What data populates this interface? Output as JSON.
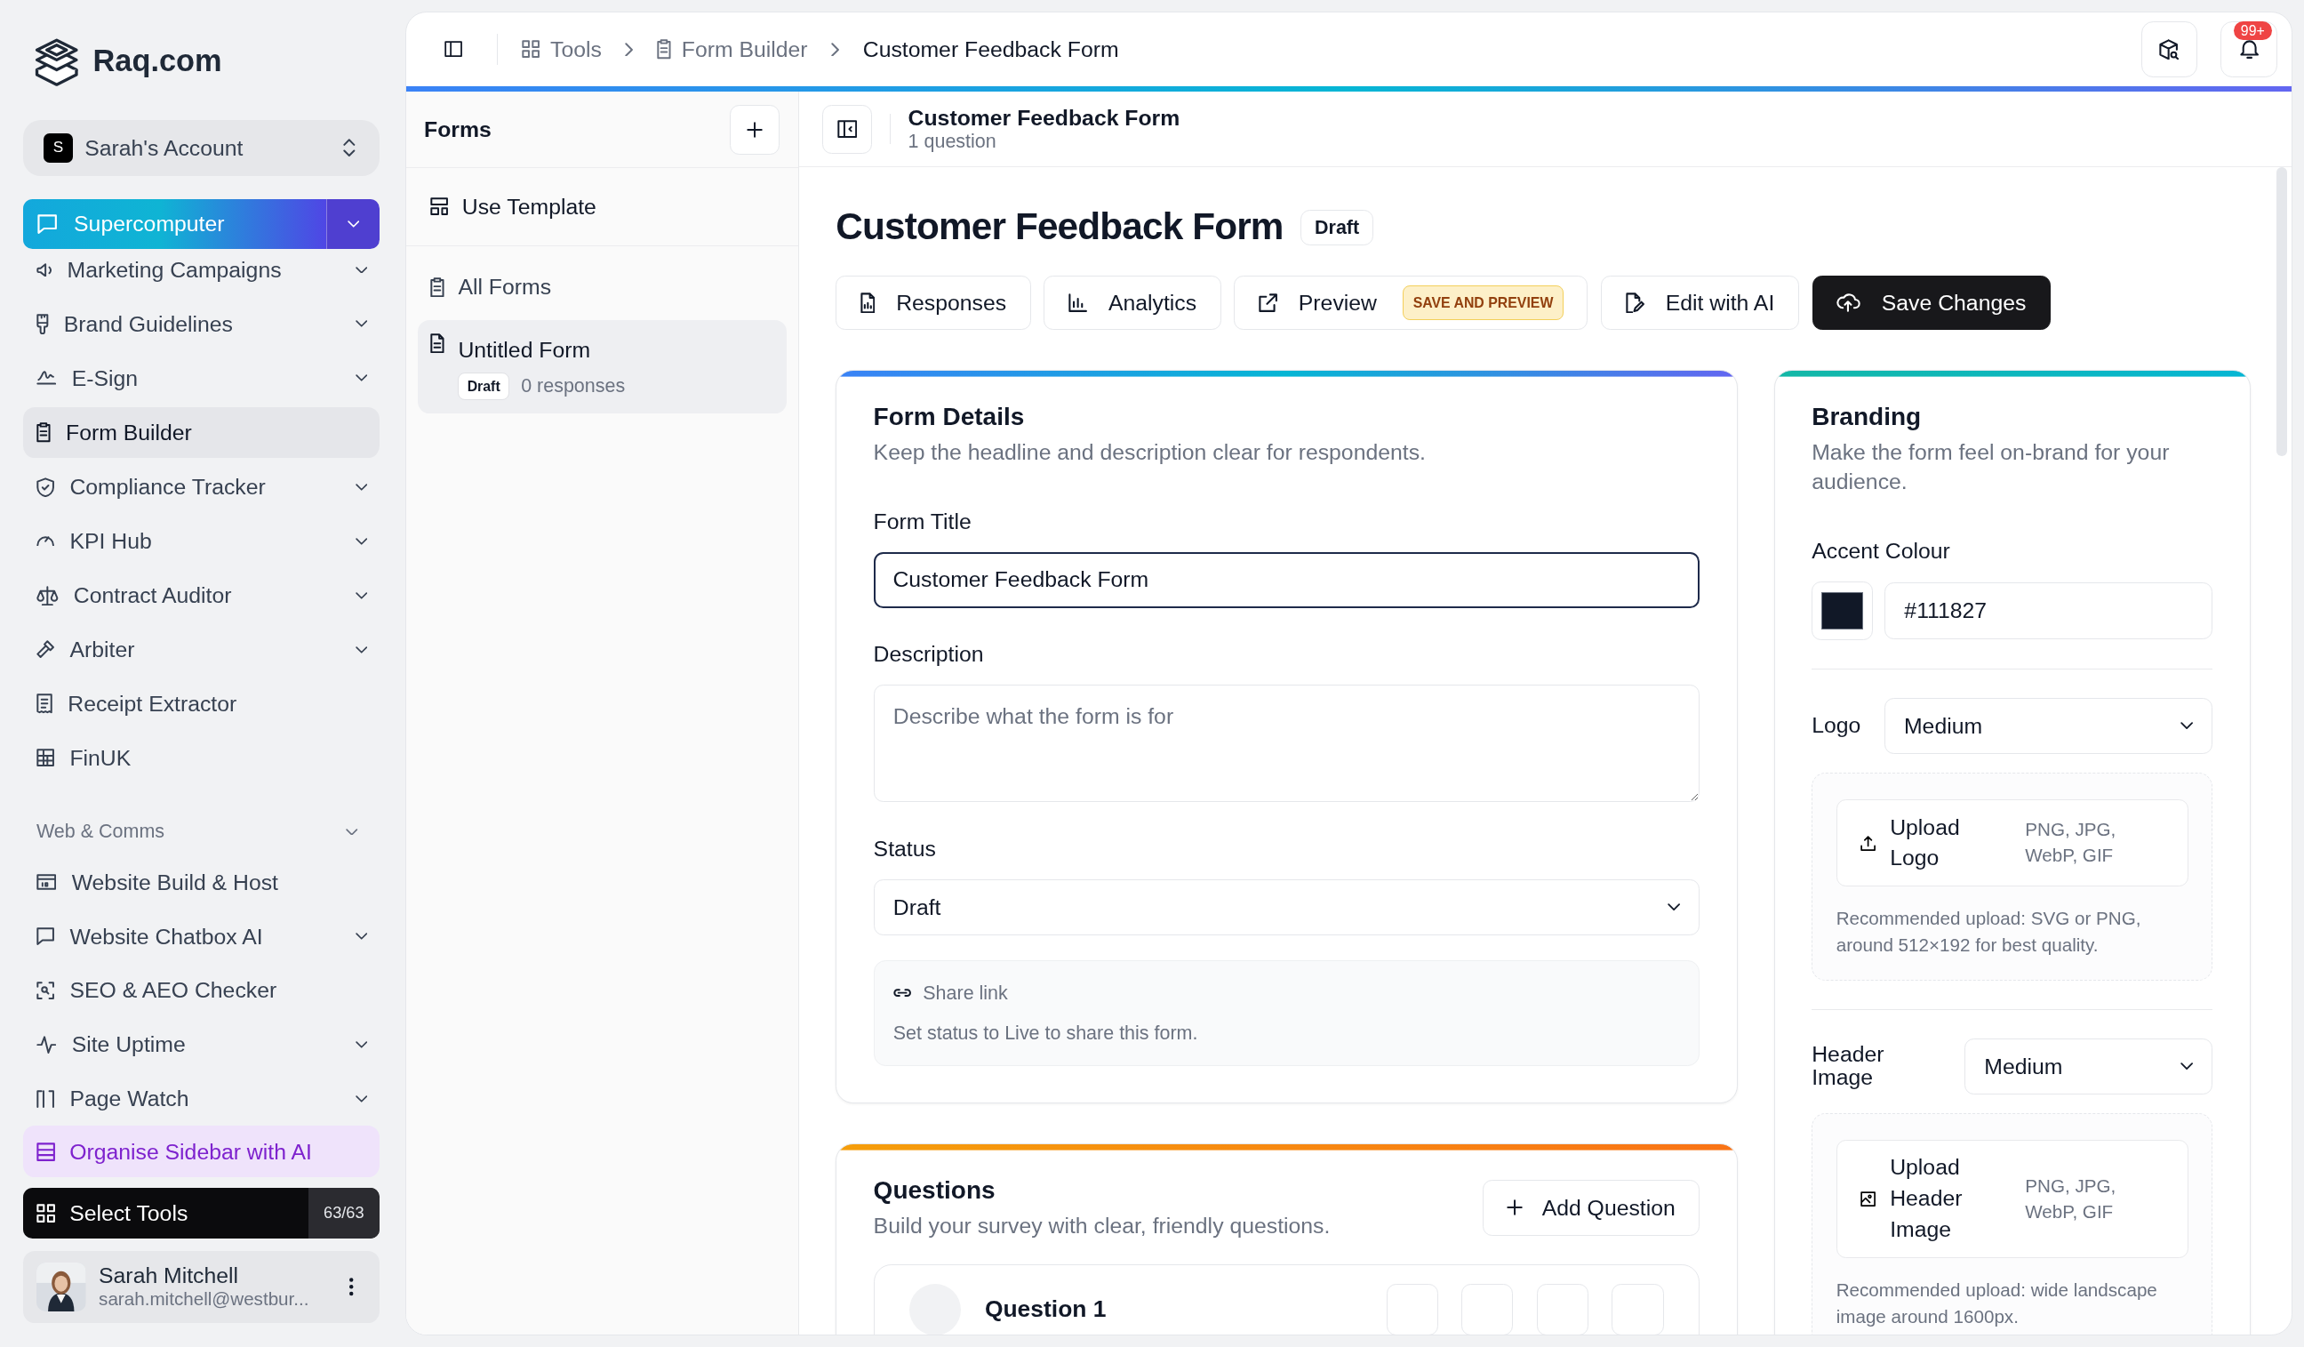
{
  "brand": {
    "name": "Raq.com"
  },
  "account": {
    "initial": "S",
    "name": "Sarah's Account"
  },
  "featured_tool": {
    "label": "Supercomputer"
  },
  "sidebar": {
    "items": [
      {
        "kind": "item",
        "label": "Marketing Campaigns",
        "expandable": true,
        "selected": false
      },
      {
        "kind": "item",
        "label": "Brand Guidelines",
        "expandable": true,
        "selected": false
      },
      {
        "kind": "item",
        "label": "E-Sign",
        "expandable": true,
        "selected": false
      },
      {
        "kind": "item",
        "label": "Form Builder",
        "expandable": false,
        "selected": true
      },
      {
        "kind": "item",
        "label": "Compliance Tracker",
        "expandable": true,
        "selected": false
      },
      {
        "kind": "item",
        "label": "KPI Hub",
        "expandable": true,
        "selected": false
      },
      {
        "kind": "item",
        "label": "Contract Auditor",
        "expandable": true,
        "selected": false
      },
      {
        "kind": "item",
        "label": "Arbiter",
        "expandable": true,
        "selected": false
      },
      {
        "kind": "item",
        "label": "Receipt Extractor",
        "expandable": false,
        "selected": false
      },
      {
        "kind": "item",
        "label": "FinUK",
        "expandable": false,
        "selected": false
      },
      {
        "kind": "heading",
        "label": "Web & Comms",
        "expanded": true
      },
      {
        "kind": "item",
        "label": "Website Build & Host",
        "expandable": false,
        "selected": false
      },
      {
        "kind": "item",
        "label": "Website Chatbox AI",
        "expandable": true,
        "selected": false
      },
      {
        "kind": "item",
        "label": "SEO & AEO Checker",
        "expandable": false,
        "selected": false
      },
      {
        "kind": "item",
        "label": "Site Uptime",
        "expandable": true,
        "selected": false
      },
      {
        "kind": "item",
        "label": "Page Watch",
        "expandable": true,
        "selected": false
      }
    ]
  },
  "organise_button": {
    "label": "Organise Sidebar with AI"
  },
  "select_tools": {
    "label": "Select Tools",
    "count": "63/63"
  },
  "user": {
    "name": "Sarah Mitchell",
    "email": "sarah.mitchell@westbur..."
  },
  "breadcrumbs": [
    {
      "label": "Tools",
      "current": false
    },
    {
      "label": "Form Builder",
      "current": false
    },
    {
      "label": "Customer Feedback Form",
      "current": true
    }
  ],
  "notifications": {
    "count": "99+"
  },
  "forms_panel": {
    "title": "Forms",
    "template": "Use Template",
    "all_forms": "All Forms",
    "forms": [
      {
        "title": "Untitled Form",
        "status": "Draft",
        "responses": "0 responses",
        "selected": true
      }
    ]
  },
  "editor_header": {
    "title": "Customer Feedback Form",
    "subtitle": "1 question"
  },
  "page": {
    "title": "Customer Feedback Form",
    "status": "Draft"
  },
  "actions": [
    {
      "label": "Responses",
      "kind": "outline"
    },
    {
      "label": "Analytics",
      "kind": "outline"
    },
    {
      "label": "Preview",
      "kind": "outline",
      "tag": "SAVE AND PREVIEW"
    },
    {
      "label": "Edit with AI",
      "kind": "outline"
    },
    {
      "label": "Save Changes",
      "kind": "primary"
    }
  ],
  "form_details": {
    "heading": "Form Details",
    "subtitle": "Keep the headline and description clear for respondents.",
    "title_field": {
      "label": "Form Title",
      "value": "Customer Feedback Form",
      "focused": true
    },
    "description_field": {
      "label": "Description",
      "placeholder": "Describe what the form is for"
    },
    "status_field": {
      "label": "Status",
      "value": "Draft"
    },
    "share": {
      "label": "Share link",
      "note": "Set status to Live to share this form."
    }
  },
  "questions": {
    "heading": "Questions",
    "subtitle": "Build your survey with clear, friendly questions.",
    "add_button": "Add Question",
    "items": [
      {
        "title": "Question 1"
      }
    ]
  },
  "branding": {
    "heading": "Branding",
    "subtitle": "Make the form feel on-brand for your audience.",
    "accent": {
      "label": "Accent Colour",
      "value": "#111827"
    },
    "logo": {
      "label": "Logo",
      "size": "Medium",
      "upload": "Upload Logo",
      "formats": "PNG, JPG, WebP, GIF",
      "note": "Recommended upload: SVG or PNG, around 512×192 for best quality."
    },
    "header_image": {
      "label": "Header Image",
      "size": "Medium",
      "upload": "Upload Header Image",
      "formats": "PNG, JPG, WebP, GIF",
      "note": "Recommended upload: wide landscape image around 1600px."
    }
  }
}
